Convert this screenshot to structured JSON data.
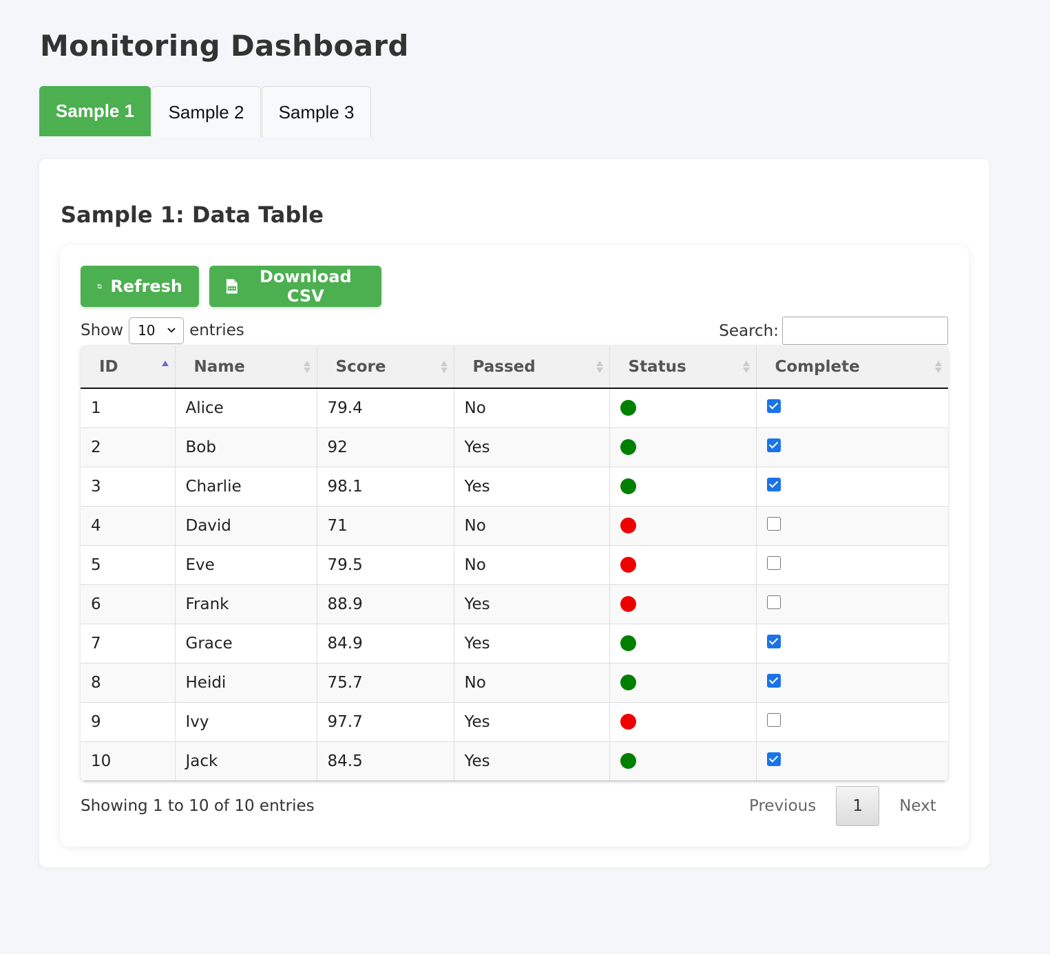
{
  "page": {
    "title": "Monitoring Dashboard"
  },
  "tabs": [
    {
      "label": "Sample 1",
      "active": true
    },
    {
      "label": "Sample 2",
      "active": false
    },
    {
      "label": "Sample 3",
      "active": false
    }
  ],
  "section": {
    "title": "Sample 1: Data Table",
    "refresh_label": "Refresh",
    "refresh_icon": "refresh-icon",
    "download_label": "Download CSV",
    "download_icon": "csv-file-icon"
  },
  "controls": {
    "show_label": "Show",
    "page_length": "10",
    "entries_label": "entries",
    "search_label": "Search:",
    "search_value": ""
  },
  "table": {
    "columns": [
      "ID",
      "Name",
      "Score",
      "Passed",
      "Status",
      "Complete"
    ],
    "sorted_column": "ID",
    "sort_direction": "asc",
    "rows": [
      {
        "id": "1",
        "name": "Alice",
        "score": "79.4",
        "passed": "No",
        "status": "green",
        "complete": true
      },
      {
        "id": "2",
        "name": "Bob",
        "score": "92",
        "passed": "Yes",
        "status": "green",
        "complete": true
      },
      {
        "id": "3",
        "name": "Charlie",
        "score": "98.1",
        "passed": "Yes",
        "status": "green",
        "complete": true
      },
      {
        "id": "4",
        "name": "David",
        "score": "71",
        "passed": "No",
        "status": "red",
        "complete": false
      },
      {
        "id": "5",
        "name": "Eve",
        "score": "79.5",
        "passed": "No",
        "status": "red",
        "complete": false
      },
      {
        "id": "6",
        "name": "Frank",
        "score": "88.9",
        "passed": "Yes",
        "status": "red",
        "complete": false
      },
      {
        "id": "7",
        "name": "Grace",
        "score": "84.9",
        "passed": "Yes",
        "status": "green",
        "complete": true
      },
      {
        "id": "8",
        "name": "Heidi",
        "score": "75.7",
        "passed": "No",
        "status": "green",
        "complete": true
      },
      {
        "id": "9",
        "name": "Ivy",
        "score": "97.7",
        "passed": "Yes",
        "status": "red",
        "complete": false
      },
      {
        "id": "10",
        "name": "Jack",
        "score": "84.5",
        "passed": "Yes",
        "status": "green",
        "complete": true
      }
    ]
  },
  "footer": {
    "info": "Showing 1 to 10 of 10 entries",
    "previous_label": "Previous",
    "current_page": "1",
    "next_label": "Next"
  },
  "colors": {
    "accent": "#4caf50",
    "status_green": "#008000",
    "status_red": "#ee0000",
    "checkbox": "#1a73e8",
    "sort_active": "#6b6bd6"
  }
}
